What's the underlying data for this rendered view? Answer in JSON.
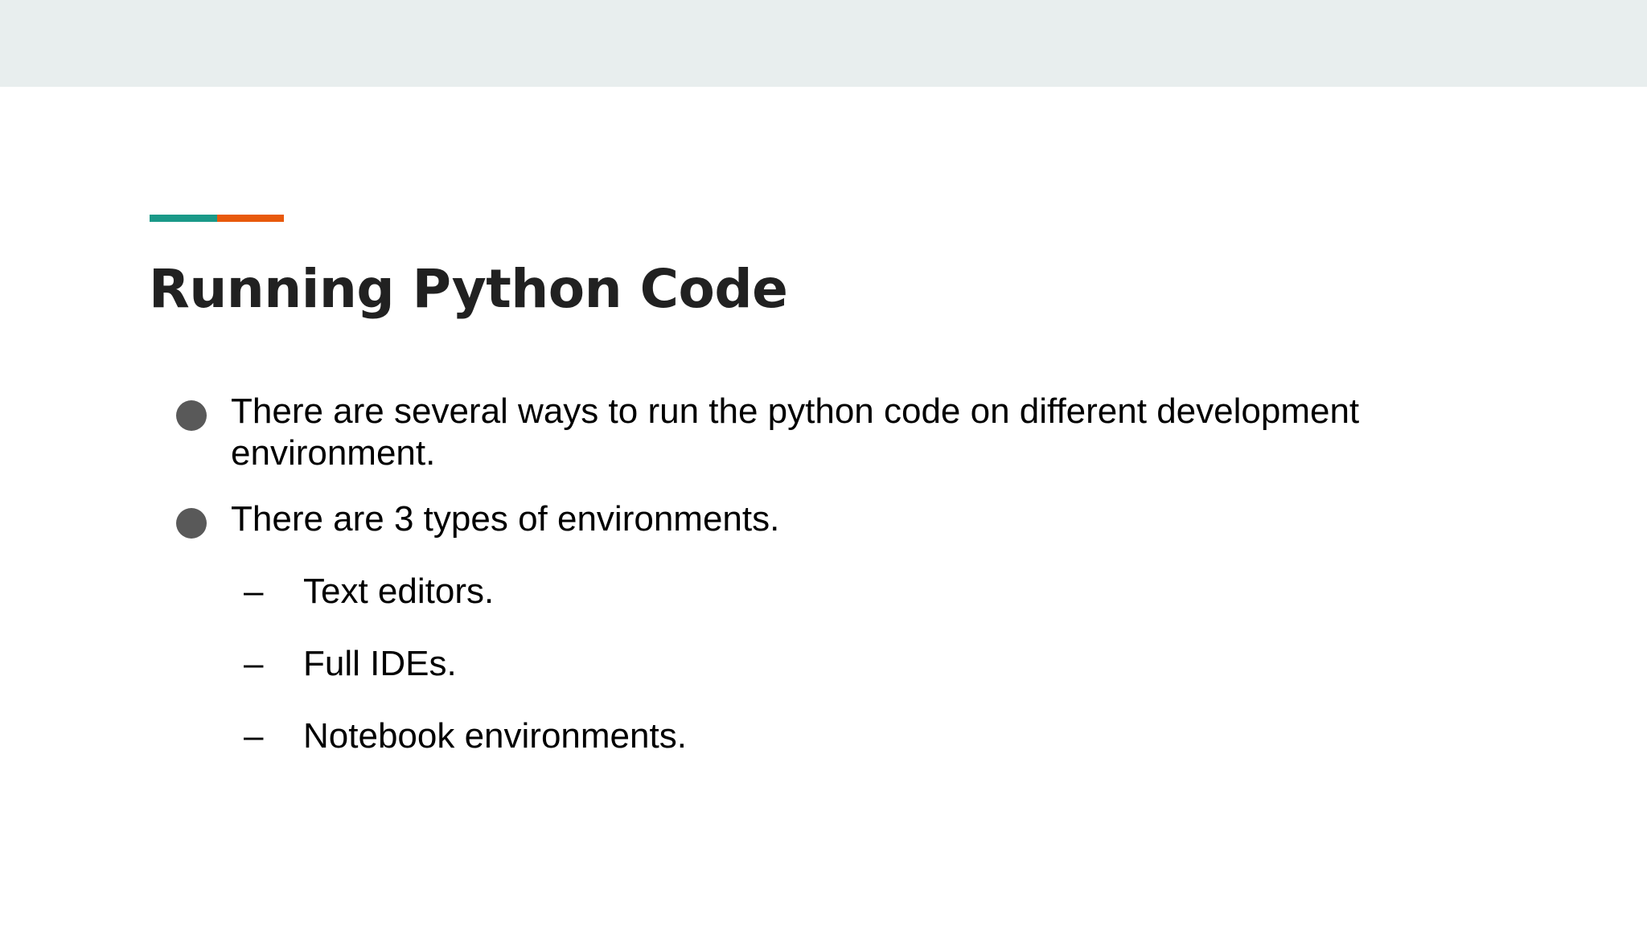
{
  "colors": {
    "top_band": "#e8eeee",
    "accent_teal": "#1a9988",
    "accent_orange": "#e8590c",
    "title_text": "#212121",
    "bullet_dot": "#595959"
  },
  "slide": {
    "title": "Running Python Code",
    "bullets": [
      {
        "text": "There are several ways to run the python code on different development environment.",
        "icon": "filled-circle"
      },
      {
        "text": "There are 3 types of environments.",
        "icon": "filled-circle"
      }
    ],
    "sub_bullets": [
      {
        "marker": "–",
        "text": "Text editors."
      },
      {
        "marker": "–",
        "text": "Full IDEs."
      },
      {
        "marker": "–",
        "text": "Notebook environments."
      }
    ]
  }
}
